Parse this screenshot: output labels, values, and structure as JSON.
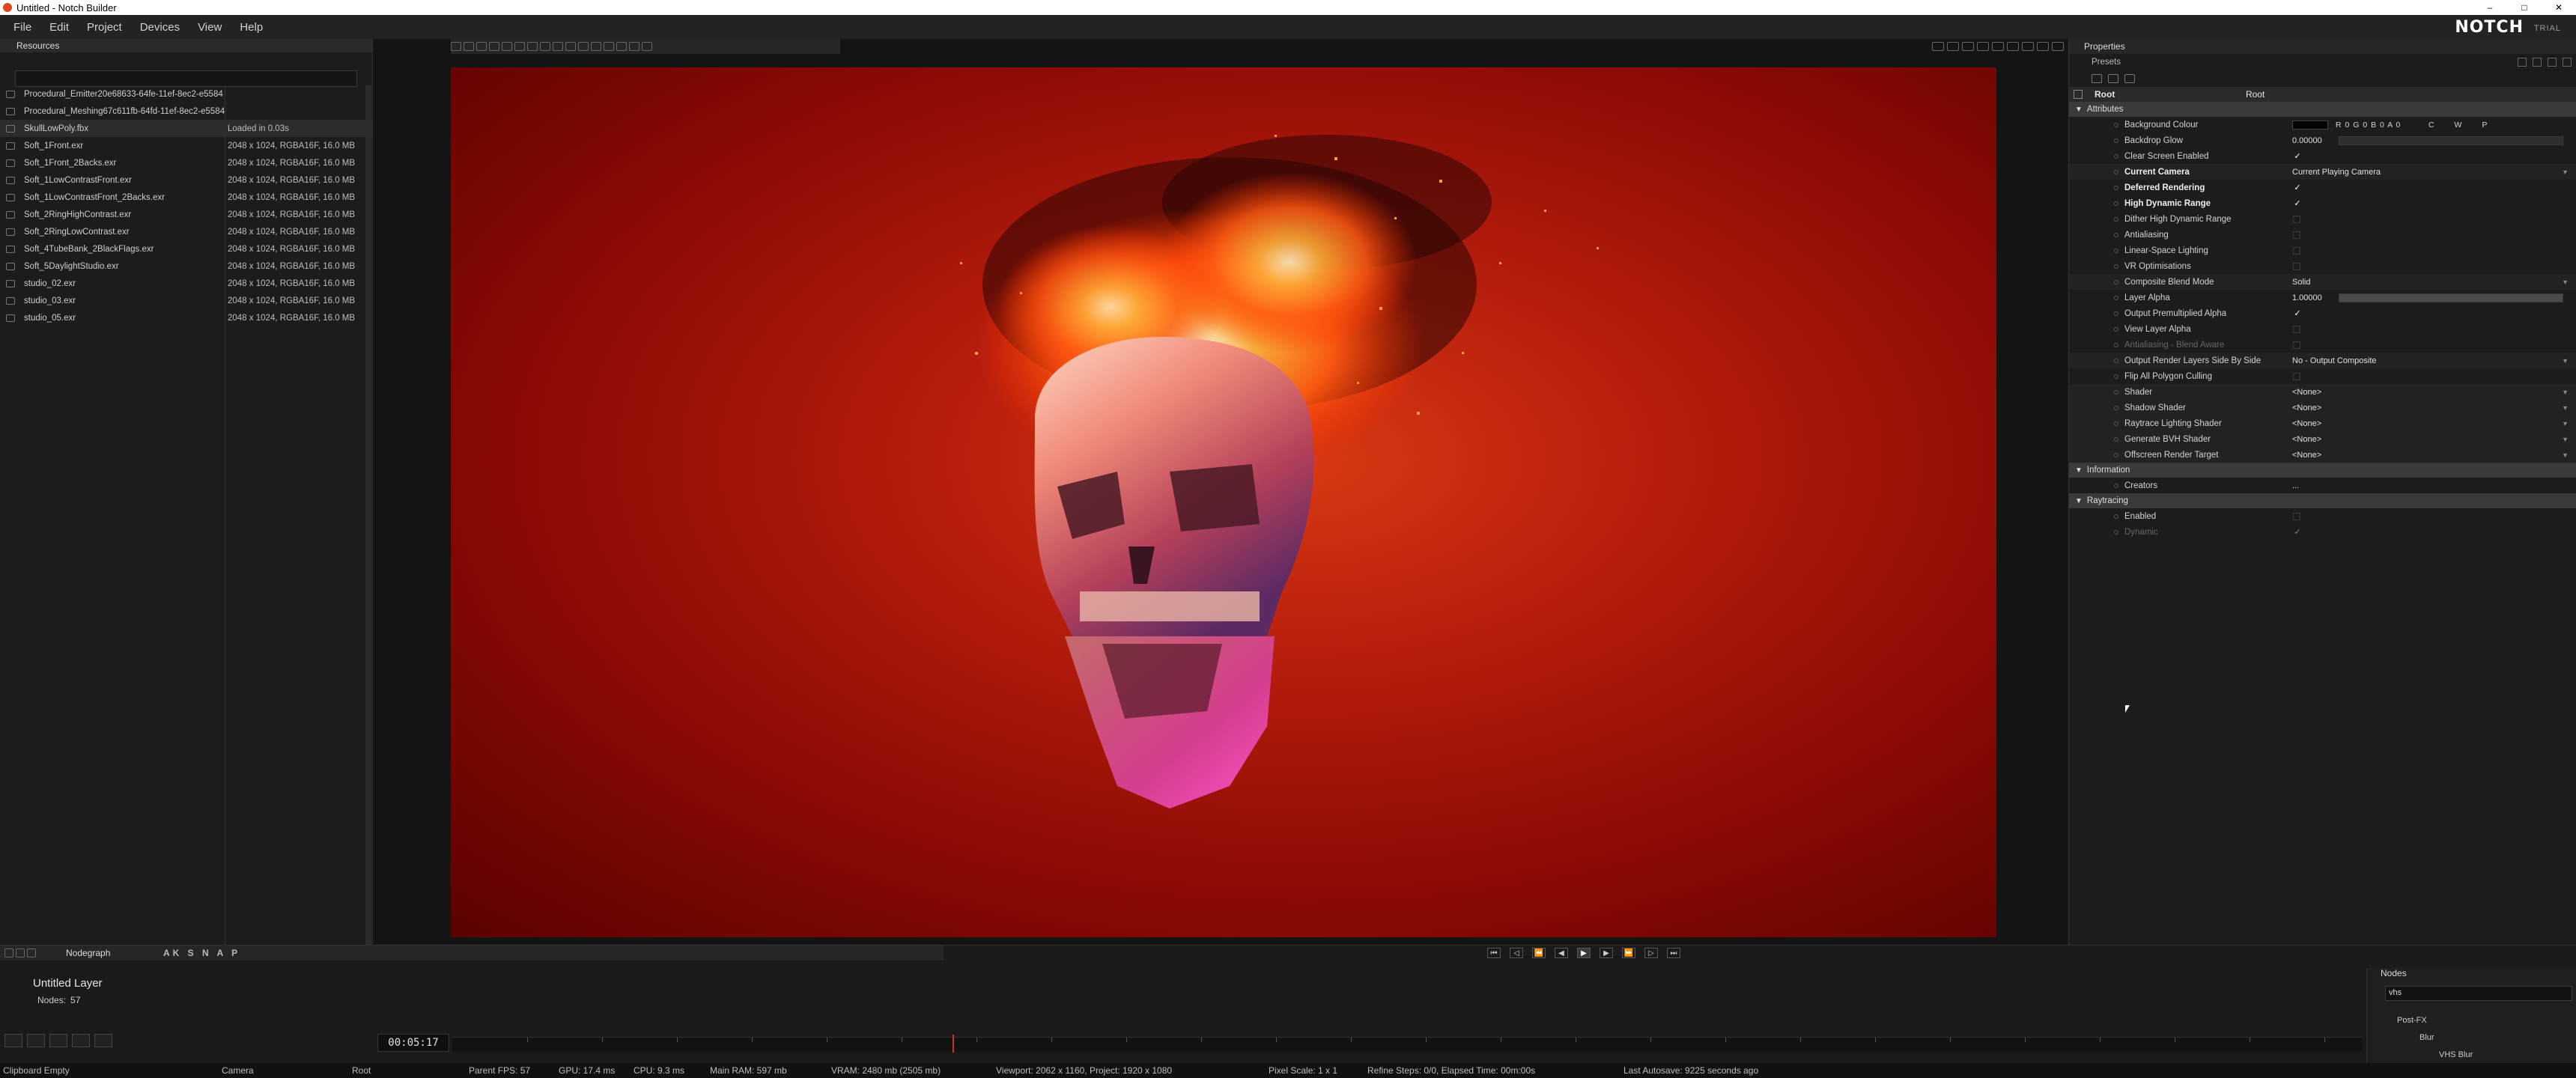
{
  "window": {
    "title": "Untitled - Notch Builder",
    "minimize": "–",
    "maximize": "□",
    "close": "✕"
  },
  "menu": [
    "File",
    "Edit",
    "Project",
    "Devices",
    "View",
    "Help"
  ],
  "brand": {
    "logo": "NOTCH",
    "trial": "TRIAL"
  },
  "resources": {
    "tab": "Resources",
    "items": [
      {
        "name": "Procedural_Emitter20e68633-64fe-11ef-8ec2-e5584",
        "info": ""
      },
      {
        "name": "Procedural_Meshing67c611fb-64fd-11ef-8ec2-e5584",
        "info": ""
      },
      {
        "name": "SkullLowPoly.fbx",
        "info": "Loaded in 0.03s"
      },
      {
        "name": "Soft_1Front.exr",
        "info": "2048 x 1024, RGBA16F, 16.0 MB"
      },
      {
        "name": "Soft_1Front_2Backs.exr",
        "info": "2048 x 1024, RGBA16F, 16.0 MB"
      },
      {
        "name": "Soft_1LowContrastFront.exr",
        "info": "2048 x 1024, RGBA16F, 16.0 MB"
      },
      {
        "name": "Soft_1LowContrastFront_2Backs.exr",
        "info": "2048 x 1024, RGBA16F, 16.0 MB"
      },
      {
        "name": "Soft_2RingHighContrast.exr",
        "info": "2048 x 1024, RGBA16F, 16.0 MB"
      },
      {
        "name": "Soft_2RingLowContrast.exr",
        "info": "2048 x 1024, RGBA16F, 16.0 MB"
      },
      {
        "name": "Soft_4TubeBank_2BlackFlags.exr",
        "info": "2048 x 1024, RGBA16F, 16.0 MB"
      },
      {
        "name": "Soft_5DaylightStudio.exr",
        "info": "2048 x 1024, RGBA16F, 16.0 MB"
      },
      {
        "name": "studio_02.exr",
        "info": "2048 x 1024, RGBA16F, 16.0 MB"
      },
      {
        "name": "studio_03.exr",
        "info": "2048 x 1024, RGBA16F, 16.0 MB"
      },
      {
        "name": "studio_05.exr",
        "info": "2048 x 1024, RGBA16F, 16.0 MB"
      }
    ]
  },
  "properties": {
    "tab": "Properties",
    "presets": "Presets",
    "root_label": "Root",
    "root_value": "Root",
    "sections": {
      "attributes": "Attributes",
      "information": "Information",
      "raytracing": "Raytracing"
    },
    "attributes": {
      "background_colour": {
        "label": "Background Colour",
        "value": "R 0 G 0 B 0 A 0",
        "cwp": "C W P"
      },
      "backdrop_glow": {
        "label": "Backdrop Glow",
        "value": "0.00000"
      },
      "clear_screen": {
        "label": "Clear Screen Enabled",
        "value": "✓"
      },
      "current_camera": {
        "label": "Current Camera",
        "value": "Current Playing Camera"
      },
      "deferred_rendering": {
        "label": "Deferred Rendering",
        "value": "✓"
      },
      "hdr": {
        "label": "High Dynamic Range",
        "value": "✓"
      },
      "dither_hdr": {
        "label": "Dither High Dynamic Range",
        "value": ""
      },
      "antialiasing": {
        "label": "Antialiasing",
        "value": ""
      },
      "linear_space": {
        "label": "Linear-Space Lighting",
        "value": ""
      },
      "vr_opt": {
        "label": "VR Optimisations",
        "value": ""
      },
      "composite_blend": {
        "label": "Composite Blend Mode",
        "value": "Solid"
      },
      "layer_alpha": {
        "label": "Layer Alpha",
        "value": "1.00000"
      },
      "output_premult": {
        "label": "Output Premultiplied Alpha",
        "value": "✓"
      },
      "view_layer_alpha": {
        "label": "View Layer Alpha",
        "value": ""
      },
      "aa_blend_aware": {
        "label": "Antialiasing - Blend Aware",
        "value": ""
      },
      "output_side_by_side": {
        "label": "Output Render Layers Side By Side",
        "value": "No - Output Composite"
      },
      "flip_culling": {
        "label": "Flip All Polygon Culling",
        "value": ""
      },
      "shader": {
        "label": "Shader",
        "value": "<None>"
      },
      "shadow_shader": {
        "label": "Shadow Shader",
        "value": "<None>"
      },
      "raytrace_shader": {
        "label": "Raytrace Lighting Shader",
        "value": "<None>"
      },
      "bvh_shader": {
        "label": "Generate BVH Shader",
        "value": "<None>"
      },
      "offscreen_target": {
        "label": "Offscreen Render Target",
        "value": "<None>"
      }
    },
    "information": {
      "creators": {
        "label": "Creators",
        "value": "..."
      }
    },
    "raytracing": {
      "enabled": {
        "label": "Enabled",
        "value": ""
      },
      "dynamic": {
        "label": "Dynamic",
        "value": "✓"
      }
    }
  },
  "nodegraph": {
    "tab": "Nodegraph",
    "letters": "AK S N A P",
    "layer_name": "Untitled   Layer",
    "nodes_label": "Nodes:",
    "nodes_count": "57"
  },
  "timeline": {
    "timecode": "00:05:17"
  },
  "nodes_panel": {
    "tab": "Nodes",
    "search": "vhs",
    "tree": [
      "Post-FX",
      "Blur",
      "VHS Blur"
    ]
  },
  "status": {
    "clipboard": "Clipboard Empty",
    "camera": "Camera",
    "root": "Root",
    "parent_fps": "Parent  FPS: 57",
    "gpu": "GPU: 17.4 ms",
    "cpu": "CPU: 9.3 ms",
    "main_ram": "Main RAM: 597 mb",
    "vram": "VRAM: 2480 mb (2505 mb)",
    "viewport": "Viewport: 2062 x 1160, Project: 1920 x 1080",
    "pixel_scale": "Pixel Scale: 1 x 1",
    "refine": "Refine Steps: 0/0, Elapsed Time: 00m:00s",
    "autosave": "Last Autosave: 9225 seconds ago"
  }
}
